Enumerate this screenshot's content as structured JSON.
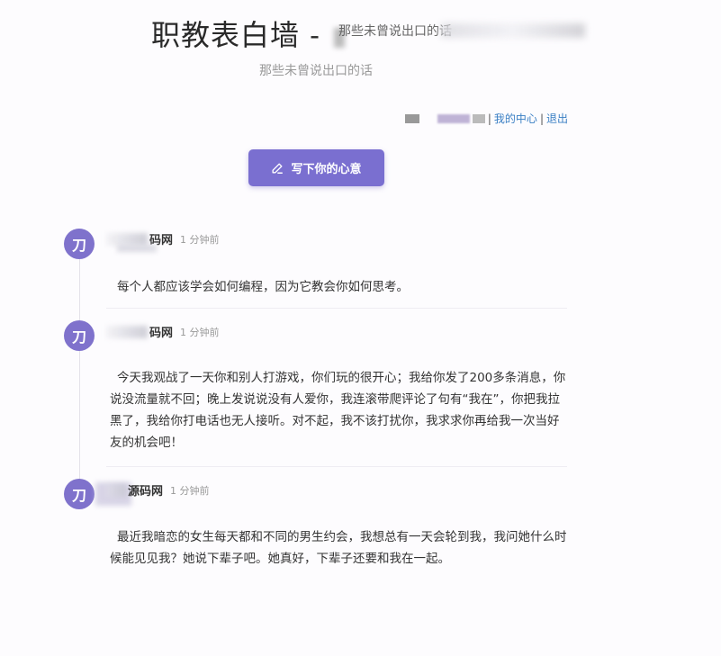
{
  "header": {
    "title": "职教表白墙 - ",
    "title_suffix": "那些未曾说出口的话",
    "subtitle": "那些未曾说出口的话"
  },
  "user_bar": {
    "separator": "|",
    "my_center": "我的中心",
    "logout": "退出"
  },
  "compose": {
    "button_label": "写下你的心意",
    "icon": "pencil-icon"
  },
  "posts": [
    {
      "avatar": "刀",
      "author": "码网",
      "time": "1 分钟前",
      "content": "每个人都应该学会如何编程，因为它教会你如何思考。"
    },
    {
      "avatar": "刀",
      "author": "码网",
      "time": "1 分钟前",
      "content": "今天我观战了一天你和别人打游戏，你们玩的很开心；我给你发了200多条消息，你说没流量就不回；晚上发说说没有人爱你，我连滚带爬评论了句有“我在”，你把我拉黑了，我给你打电话也无人接听。对不起，我不该打扰你，我求求你再给我一次当好友的机会吧！"
    },
    {
      "avatar": "刀",
      "author": "源码网",
      "time": "1 分钟前",
      "content": "最近我暗恋的女生每天都和不同的男生约会，我想总有一天会轮到我，我问她什么时候能见见我？她说下辈子吧。她真好，下辈子还要和我在一起。"
    }
  ],
  "colors": {
    "accent": "#7a6fd0",
    "avatar": "#7f72cc",
    "link": "#3a7fc4"
  }
}
